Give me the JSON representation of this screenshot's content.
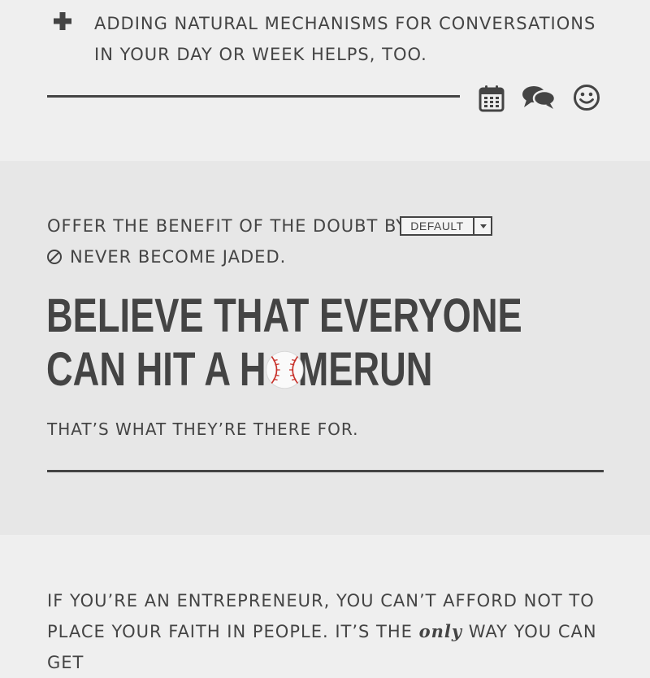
{
  "tip": {
    "text": "Adding natural mechanisms for conversations in your day or week helps, too."
  },
  "tip_actions": [
    {
      "icon": "calendar-icon"
    },
    {
      "icon": "chat-bubbles-icon"
    },
    {
      "icon": "smiley-icon"
    }
  ],
  "benefit": {
    "prefix": "Offer the benefit of the doubt by",
    "dropdown_value": "DEFAULT",
    "jaded": "Never become jaded."
  },
  "headline": {
    "line1": "BELIEVE THAT EVERYONE",
    "line2_before": "CAN HIT A H",
    "line2_after": "MERUN"
  },
  "subline": "That’s what they’re there for.",
  "paragraph": {
    "before": "If you’re an entrepreneur, you can’t afford not to place your faith in people. It’s the ",
    "emphasis": "only",
    "after": " way you can get"
  },
  "colors": {
    "text": "#444444",
    "background_light": "#efefef",
    "background_band": "#e7e7e7",
    "baseball_stitch": "#c8312a"
  }
}
